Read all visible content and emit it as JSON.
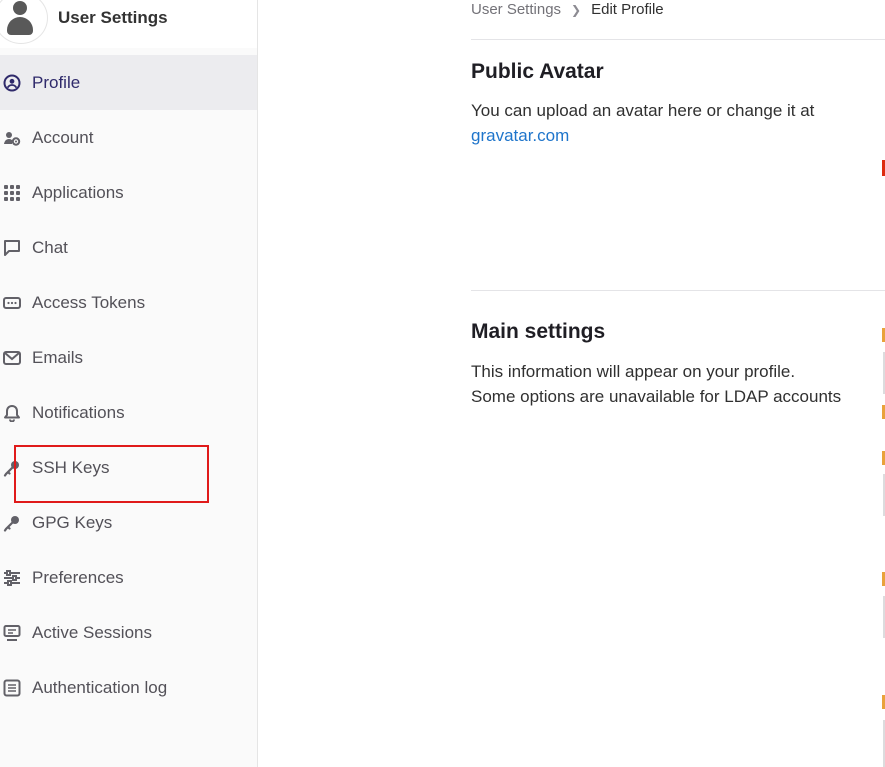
{
  "sidebar": {
    "title": "User Settings",
    "items": [
      {
        "label": "Profile",
        "icon": "profile-icon",
        "active": true
      },
      {
        "label": "Account",
        "icon": "account-icon"
      },
      {
        "label": "Applications",
        "icon": "applications-icon"
      },
      {
        "label": "Chat",
        "icon": "chat-icon"
      },
      {
        "label": "Access Tokens",
        "icon": "token-icon"
      },
      {
        "label": "Emails",
        "icon": "mail-icon"
      },
      {
        "label": "Notifications",
        "icon": "bell-icon"
      },
      {
        "label": "SSH Keys",
        "icon": "key-icon"
      },
      {
        "label": "GPG Keys",
        "icon": "key-icon"
      },
      {
        "label": "Preferences",
        "icon": "preferences-icon"
      },
      {
        "label": "Active Sessions",
        "icon": "monitor-icon"
      },
      {
        "label": "Authentication log",
        "icon": "log-icon"
      }
    ]
  },
  "breadcrumb": {
    "parent": "User Settings",
    "current": "Edit Profile"
  },
  "avatar_section": {
    "title": "Public Avatar",
    "text": "You can upload an avatar here or change it at",
    "link": "gravatar.com"
  },
  "main_settings": {
    "title": "Main settings",
    "line1": "This information will appear on your profile.",
    "line2": "Some options are unavailable for LDAP accounts"
  },
  "colors": {
    "active_text": "#2f2a6b",
    "link": "#1f75cb",
    "highlight": "#e01a1a"
  }
}
